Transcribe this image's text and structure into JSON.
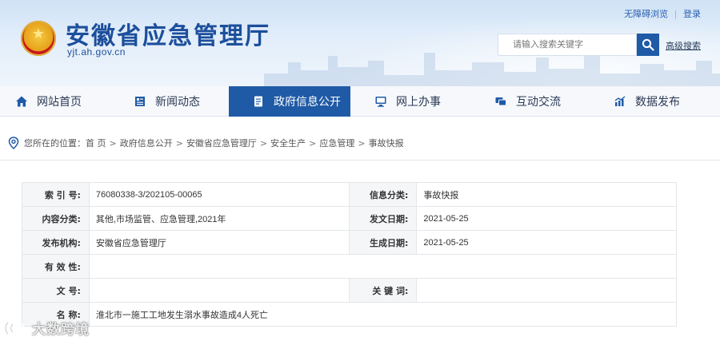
{
  "header": {
    "site_title": "安徽省应急管理厅",
    "domain": "yjt.ah.gov.cn",
    "accessibility_link": "无障碍浏览",
    "login_link": "登录",
    "search_placeholder": "请输入搜索关键字",
    "advanced_search": "高级搜索"
  },
  "nav": {
    "items": [
      {
        "label": "网站首页",
        "icon": "home-icon"
      },
      {
        "label": "新闻动态",
        "icon": "news-icon"
      },
      {
        "label": "政府信息公开",
        "icon": "document-icon",
        "active": true
      },
      {
        "label": "网上办事",
        "icon": "monitor-icon"
      },
      {
        "label": "互动交流",
        "icon": "chat-icon"
      },
      {
        "label": "数据发布",
        "icon": "chart-icon"
      }
    ]
  },
  "breadcrumb": {
    "prefix": "您所在的位置：",
    "items": [
      "首 页",
      "政府信息公开",
      "安徽省应急管理厅",
      "安全生产",
      "应急管理",
      "事故快报"
    ]
  },
  "info": {
    "index_label": "索 引 号:",
    "index_value": "76080338-3/202105-00065",
    "category_label": "信息分类:",
    "category_value": "事故快报",
    "content_label": "内容分类:",
    "content_value": "其他,市场监管、应急管理,2021年",
    "issue_date_label": "发文日期:",
    "issue_date_value": "2021-05-25",
    "publisher_label": "发布机构:",
    "publisher_value": "安徽省应急管理厅",
    "created_date_label": "生成日期:",
    "created_date_value": "2021-05-25",
    "validity_label": "有 效 性:",
    "validity_value": "",
    "docno_label": "文 号:",
    "docno_value": "",
    "keywords_label": "关 键 词:",
    "keywords_value": "",
    "name_label": "名 称:",
    "name_value": "淮北市一施工工地发生溺水事故造成4人死亡"
  },
  "watermark": "大数跨境"
}
